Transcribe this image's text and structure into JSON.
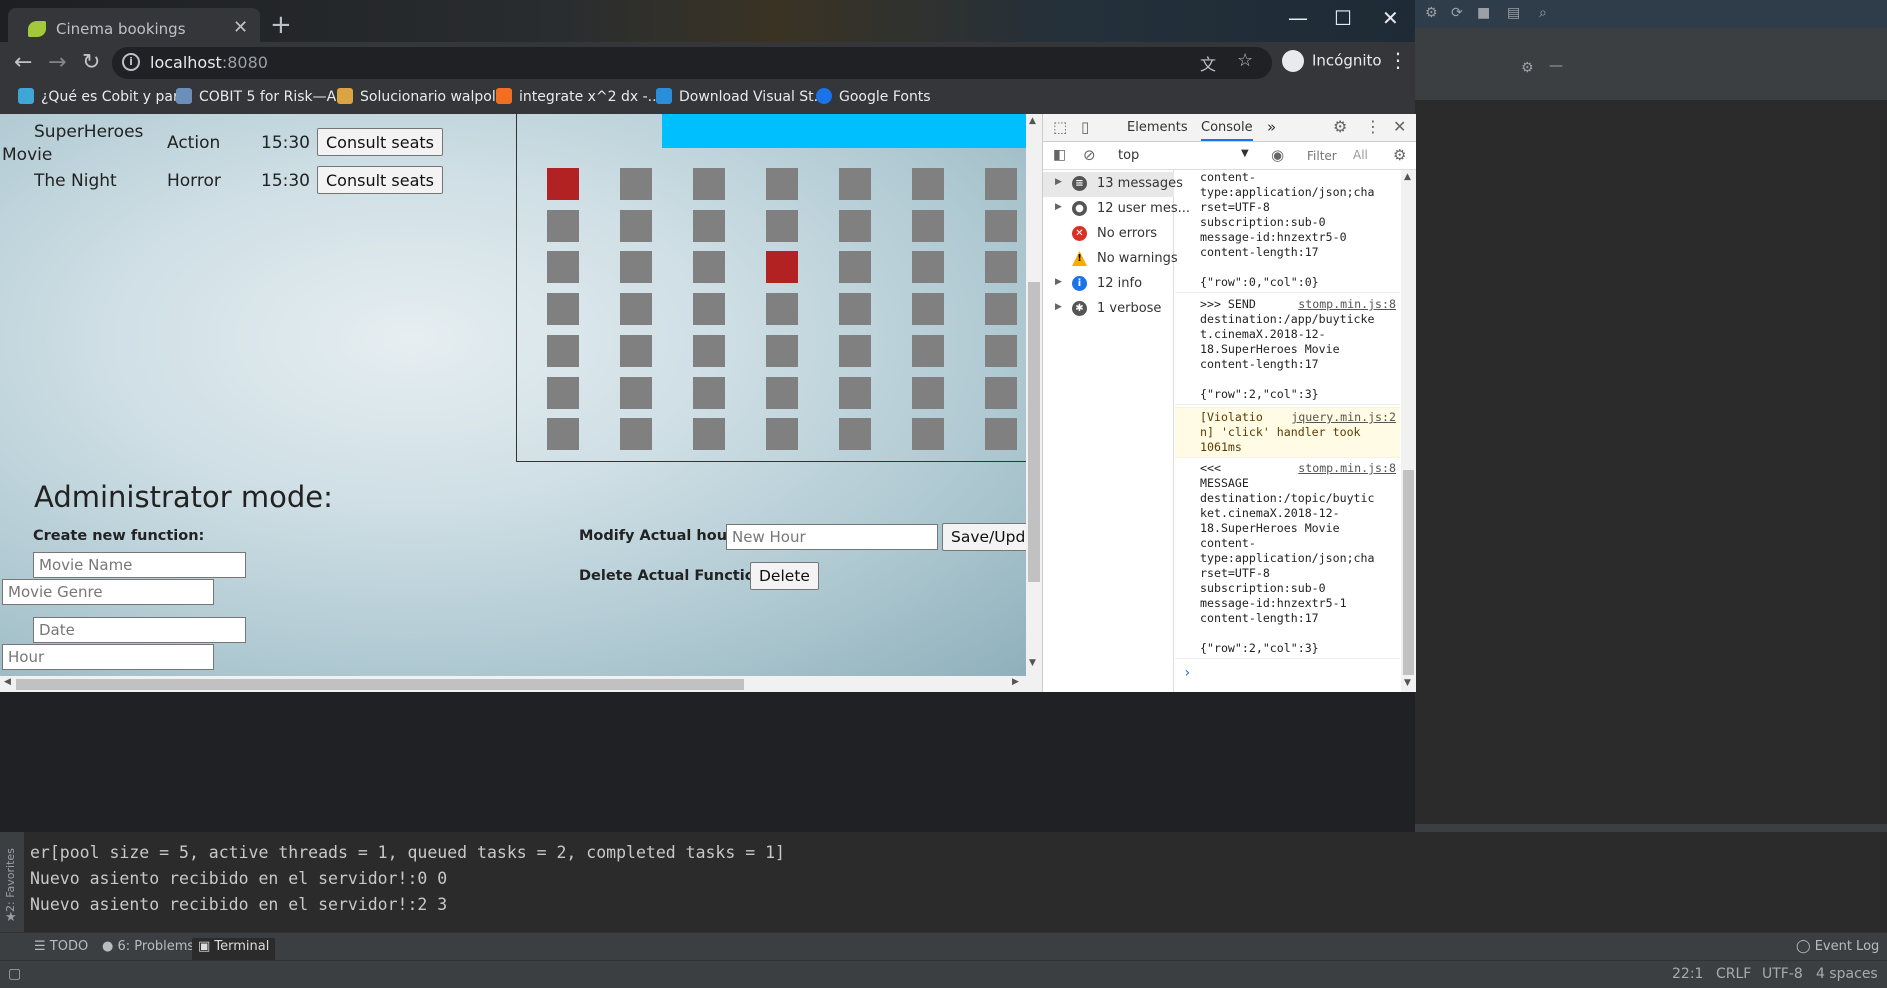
{
  "browser": {
    "tab_title": "Cinema bookings",
    "tab_close": "✕",
    "new_tab": "+",
    "window_controls": {
      "minimize": "—",
      "maximize": "☐",
      "close": "✕"
    },
    "url_host": "localhost",
    "url_port": ":8080",
    "incognito_label": "Incógnito",
    "bookmarks": [
      {
        "label": "¿Qué es Cobit y par...",
        "color": "#3fa7d6"
      },
      {
        "label": "COBIT 5 for Risk—A...",
        "color": "#6a8fb8"
      },
      {
        "label": "Solucionario walpol...",
        "color": "#d9a441"
      },
      {
        "label": "integrate x^2 dx -...",
        "color": "#f26f21"
      },
      {
        "label": "Download Visual St...",
        "color": "#2a8fd8"
      },
      {
        "label": "Google Fonts",
        "color": "#1a73e8"
      }
    ]
  },
  "page": {
    "functions": [
      {
        "name_line1": "SuperHeroes",
        "name_line2": "Movie",
        "genre": "Action",
        "hour": "15:30",
        "button": "Consult seats"
      },
      {
        "name_line1": "The Night",
        "name_line2": "",
        "genre": "Horror",
        "hour": "15:30",
        "button": "Consult seats"
      }
    ],
    "seats": {
      "rows": 7,
      "cols": 7,
      "taken": [
        [
          0,
          0
        ],
        [
          2,
          3
        ]
      ],
      "free_color": "#808080",
      "taken_color": "#b22222",
      "screen_color": "#00bfff"
    },
    "admin": {
      "title": "Administrator mode:",
      "create_label": "Create new function:",
      "movie_name_placeholder": "Movie Name",
      "movie_genre_placeholder": "Movie Genre",
      "date_placeholder": "Date",
      "hour_placeholder": "Hour",
      "modify_label": "Modify Actual hour:",
      "new_hour_placeholder": "New Hour",
      "save_button": "Save/Update",
      "delete_label": "Delete Actual Function:",
      "delete_button": "Delete"
    }
  },
  "devtools": {
    "tabs": {
      "elements": "Elements",
      "console": "Console",
      "more": "»"
    },
    "context": "top",
    "filter_placeholder": "Filter",
    "levels": "All",
    "sidebar": [
      {
        "label": "13 messages",
        "icon": "list-icon",
        "color": "#555",
        "glyph": "≡"
      },
      {
        "label": "12 user mes...",
        "icon": "user-icon",
        "color": "#555",
        "glyph": "●"
      },
      {
        "label": "No errors",
        "icon": "error-icon",
        "color": "#d93025",
        "glyph": "✕"
      },
      {
        "label": "No warnings",
        "icon": "warning-icon",
        "color": "#f9ab00",
        "glyph": "!"
      },
      {
        "label": "12 info",
        "icon": "info-icon",
        "color": "#1a73e8",
        "glyph": "i"
      },
      {
        "label": "1 verbose",
        "icon": "bug-icon",
        "color": "#555",
        "glyph": "✱"
      }
    ],
    "messages": [
      {
        "text": "content-\ntype:application/json;cha\nrset=UTF-8\nsubscription:sub-0\nmessage-id:hnzextr5-0\ncontent-length:17\n\n{\"row\":0,\"col\":0}",
        "src": "",
        "warn": false
      },
      {
        "text": ">>> SEND\ndestination:/app/buyticke\nt.cinemaX.2018-12-\n18.SuperHeroes Movie\ncontent-length:17\n\n{\"row\":2,\"col\":3}",
        "src": "stomp.min.js:8",
        "warn": false
      },
      {
        "text": "[Violatio\nn] 'click' handler took\n1061ms",
        "src": "jquery.min.js:2",
        "warn": true
      },
      {
        "text": "<<<\nMESSAGE\ndestination:/topic/buytic\nket.cinemaX.2018-12-\n18.SuperHeroes Movie\ncontent-\ntype:application/json;cha\nrset=UTF-8\nsubscription:sub-0\nmessage-id:hnzextr5-1\ncontent-length:17\n\n{\"row\":2,\"col\":3}",
        "src": "stomp.min.js:8",
        "warn": false
      }
    ],
    "prompt": "›"
  },
  "terminal": {
    "lines": [
      "er[pool size = 5, active threads = 1, queued tasks = 2, completed tasks = 1]",
      "Nuevo asiento recibido en el servidor!:0 0",
      "Nuevo asiento recibido en el servidor!:2 3"
    ],
    "favorites_label": "2: Favorites"
  },
  "ide": {
    "bottom_tabs": [
      {
        "label": "TODO",
        "active": false
      },
      {
        "label": "6: Problems",
        "active": false
      },
      {
        "label": "Terminal",
        "active": true
      }
    ],
    "event_log": "Event Log",
    "status": {
      "position": "22:1",
      "line_sep": "CRLF",
      "encoding": "UTF-8",
      "indent": "4 spaces"
    }
  }
}
